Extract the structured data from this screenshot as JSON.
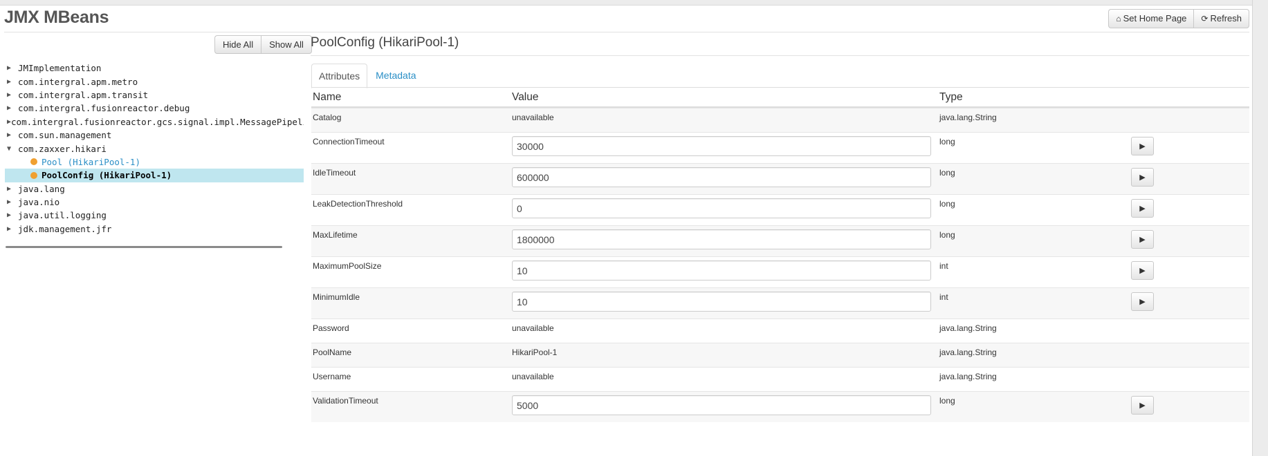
{
  "app": {
    "title": "JMX MBeans",
    "set_home_label": "Set Home Page",
    "refresh_label": "Refresh",
    "home_icon": "home-icon",
    "refresh_icon": "refresh-icon"
  },
  "tree": {
    "hide_all_label": "Hide All",
    "show_all_label": "Show All",
    "items": [
      {
        "label": "JMImplementation",
        "expanded": false
      },
      {
        "label": "com.intergral.apm.metro",
        "expanded": false
      },
      {
        "label": "com.intergral.apm.transit",
        "expanded": false
      },
      {
        "label": "com.intergral.fusionreactor.debug",
        "expanded": false
      },
      {
        "label": "com.intergral.fusionreactor.gcs.signal.impl.MessagePipeline",
        "expanded": false
      },
      {
        "label": "com.sun.management",
        "expanded": false
      },
      {
        "label": "com.zaxxer.hikari",
        "expanded": true
      },
      {
        "label": "Pool (HikariPool-1)",
        "child": true
      },
      {
        "label": "PoolConfig (HikariPool-1)",
        "child": true,
        "selected": true
      },
      {
        "label": "java.lang",
        "expanded": false
      },
      {
        "label": "java.nio",
        "expanded": false
      },
      {
        "label": "java.util.logging",
        "expanded": false
      },
      {
        "label": "jdk.management.jfr",
        "expanded": false
      }
    ]
  },
  "main": {
    "title": "PoolConfig (HikariPool-1)",
    "tabs": [
      {
        "label": "Attributes",
        "active": true
      },
      {
        "label": "Metadata",
        "active": false
      }
    ],
    "columns": {
      "name": "Name",
      "value": "Value",
      "type": "Type"
    },
    "rows": [
      {
        "name": "Catalog",
        "value": "unavailable",
        "type": "java.lang.String",
        "editable": false
      },
      {
        "name": "ConnectionTimeout",
        "value": "30000",
        "type": "long",
        "editable": true
      },
      {
        "name": "IdleTimeout",
        "value": "600000",
        "type": "long",
        "editable": true
      },
      {
        "name": "LeakDetectionThreshold",
        "value": "0",
        "type": "long",
        "editable": true
      },
      {
        "name": "MaxLifetime",
        "value": "1800000",
        "type": "long",
        "editable": true
      },
      {
        "name": "MaximumPoolSize",
        "value": "10",
        "type": "int",
        "editable": true
      },
      {
        "name": "MinimumIdle",
        "value": "10",
        "type": "int",
        "editable": true
      },
      {
        "name": "Password",
        "value": "unavailable",
        "type": "java.lang.String",
        "editable": false
      },
      {
        "name": "PoolName",
        "value": "HikariPool-1",
        "type": "java.lang.String",
        "editable": false
      },
      {
        "name": "Username",
        "value": "unavailable",
        "type": "java.lang.String",
        "editable": false
      },
      {
        "name": "ValidationTimeout",
        "value": "5000",
        "type": "long",
        "editable": true
      }
    ]
  }
}
